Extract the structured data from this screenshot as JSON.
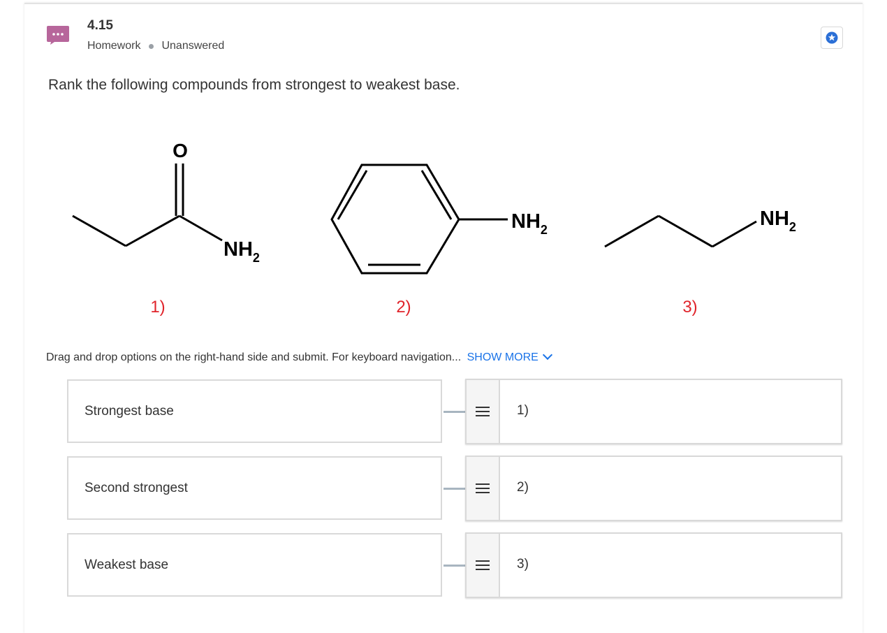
{
  "header": {
    "question_number": "4.15",
    "category": "Homework",
    "status": "Unanswered"
  },
  "question": {
    "prompt": "Rank the following compounds from strongest to weakest base."
  },
  "compounds": {
    "c1": {
      "number_label": "1)",
      "atom_o": "O",
      "group_nh": "NH",
      "group_sub": "2"
    },
    "c2": {
      "number_label": "2)",
      "group_nh": "NH",
      "group_sub": "2"
    },
    "c3": {
      "number_label": "3)",
      "group_nh": "NH",
      "group_sub": "2"
    },
    "label_color": "#e0242b"
  },
  "instructions": {
    "text": "Drag and drop options on the right-hand side and submit. For keyboard navigation...",
    "show_more": "SHOW MORE"
  },
  "targets": [
    {
      "label": "Strongest base"
    },
    {
      "label": "Second strongest"
    },
    {
      "label": "Weakest base"
    }
  ],
  "options": [
    {
      "label": "1)"
    },
    {
      "label": "2)"
    },
    {
      "label": "3)"
    }
  ],
  "colors": {
    "avatar": "#b7669b",
    "link": "#1a73e8",
    "bookmark": "#2b6fd6"
  },
  "icons": {
    "header": "chat-bubble-icon",
    "bookmark": "star-bookmark-icon",
    "drag": "drag-handle-icon"
  }
}
